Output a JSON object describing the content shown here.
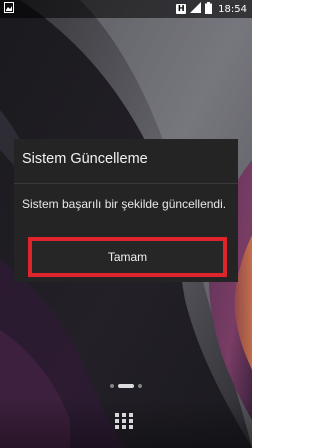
{
  "status_bar": {
    "left_icon": "image-icon",
    "h_badge": "H",
    "time": "18:54",
    "icons": [
      "image-icon",
      "network-h-icon",
      "signal-icon",
      "battery-icon"
    ]
  },
  "dialog": {
    "title": "Sistem Güncelleme",
    "message": "Sistem başarılı bir şekilde güncellendi.",
    "ok_label": "Tamam"
  },
  "home": {
    "page_count": 3,
    "active_page": 2,
    "apps_icon": "app-drawer-icon"
  },
  "colors": {
    "highlight": "#e0242b",
    "dialog_bg": "#242424"
  }
}
